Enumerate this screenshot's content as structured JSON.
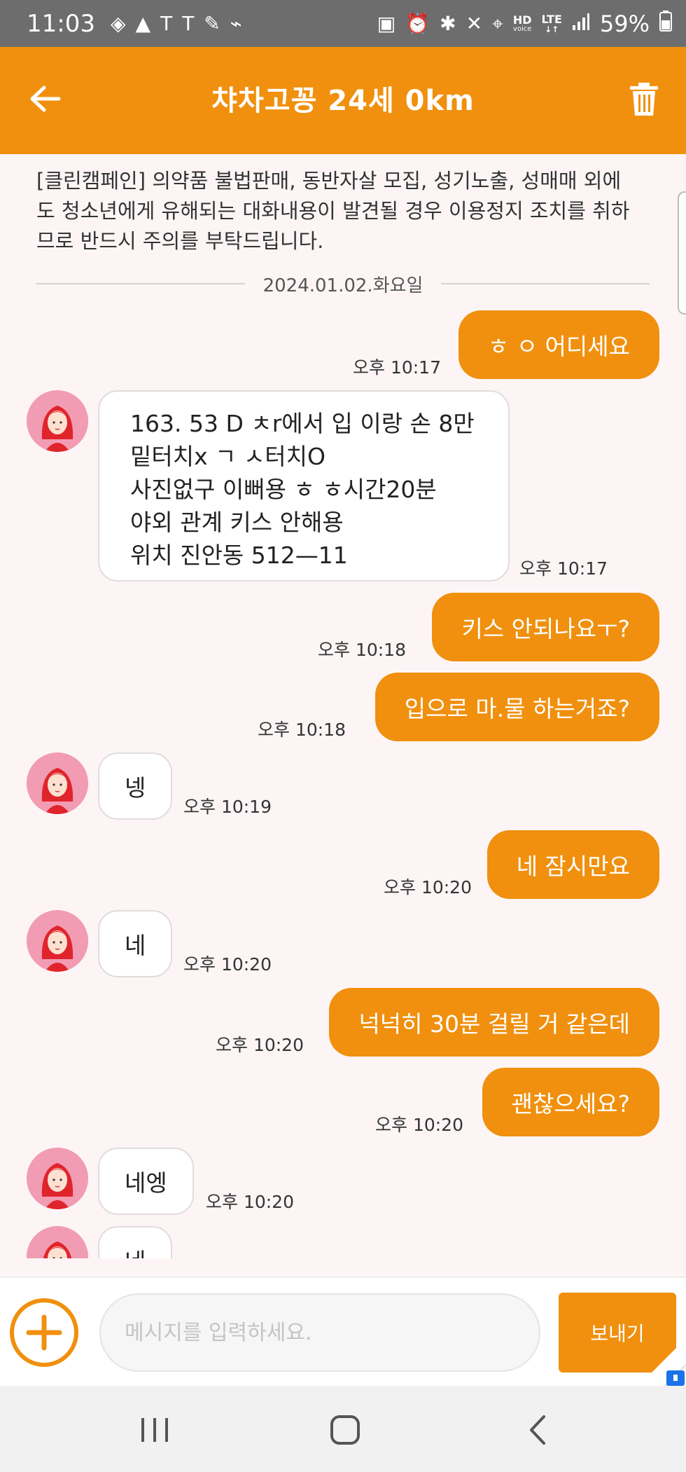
{
  "status_bar": {
    "time": "11:03",
    "left_icons": [
      "maps-icon",
      "navigation-icon",
      "t-app-icon",
      "t-app-icon-2",
      "running-shoe-icon",
      "shoe-icon"
    ],
    "right_icons": [
      "folder-icon",
      "alarm-icon",
      "bluetooth-icon",
      "mute-icon",
      "location-icon"
    ],
    "hd_label": "HD",
    "voice_label": "voice",
    "lte_label": "LTE",
    "battery": "59%"
  },
  "header": {
    "title": "챠차고꽁 24세 0km",
    "back_icon": "arrow-left-icon",
    "delete_icon": "trash-icon",
    "color": "#f0900e"
  },
  "notice": "[클린캠페인] 의약품 불법판매, 동반자살 모집, 성기노출, 성매매 외에도 청소년에게 유해되는 대화내용이 발견될 경우 이용정지 조치를 취하므로 반드시 주의를 부탁드립니다.",
  "date_divider": "2024.01.02.화요일",
  "messages": [
    {
      "dir": "out",
      "text": "ㅎ ㅇ 어디세요",
      "time": "오후 10:17"
    },
    {
      "dir": "in",
      "lines": [
        "163. 53 D ㅊr에서 입 이랑 손 8만",
        "밑터치x ㄱ ㅅ터치O",
        "사진없구 이뻐용 ㅎ ㅎ시간20분",
        "야외 관계 키스 안해용",
        "위치 진안동 512—11"
      ],
      "time": "오후 10:17"
    },
    {
      "dir": "out",
      "text": "키스 안되나요ㅜ?",
      "time": "오후 10:18"
    },
    {
      "dir": "out",
      "text": "입으로 마.물 하는거죠?",
      "time": "오후 10:18"
    },
    {
      "dir": "in",
      "text": "넹",
      "time": "오후 10:19"
    },
    {
      "dir": "out",
      "text": "네 잠시만요",
      "time": "오후 10:20"
    },
    {
      "dir": "in",
      "text": "네",
      "time": "오후 10:20"
    },
    {
      "dir": "out",
      "text": "넉넉히 30분 걸릴 거 같은데",
      "time": "오후 10:20"
    },
    {
      "dir": "out",
      "text": "괜찮으세요?",
      "time": "오후 10:20"
    },
    {
      "dir": "in",
      "text": "네엥",
      "time": "오후 10:20"
    },
    {
      "dir": "in",
      "text": "네",
      "time": ""
    }
  ],
  "input": {
    "placeholder": "메시지를 입력하세요.",
    "send_label": "보내기",
    "add_icon": "plus-circle-icon"
  },
  "nav": [
    "recent-apps-icon",
    "home-icon",
    "back-icon"
  ]
}
